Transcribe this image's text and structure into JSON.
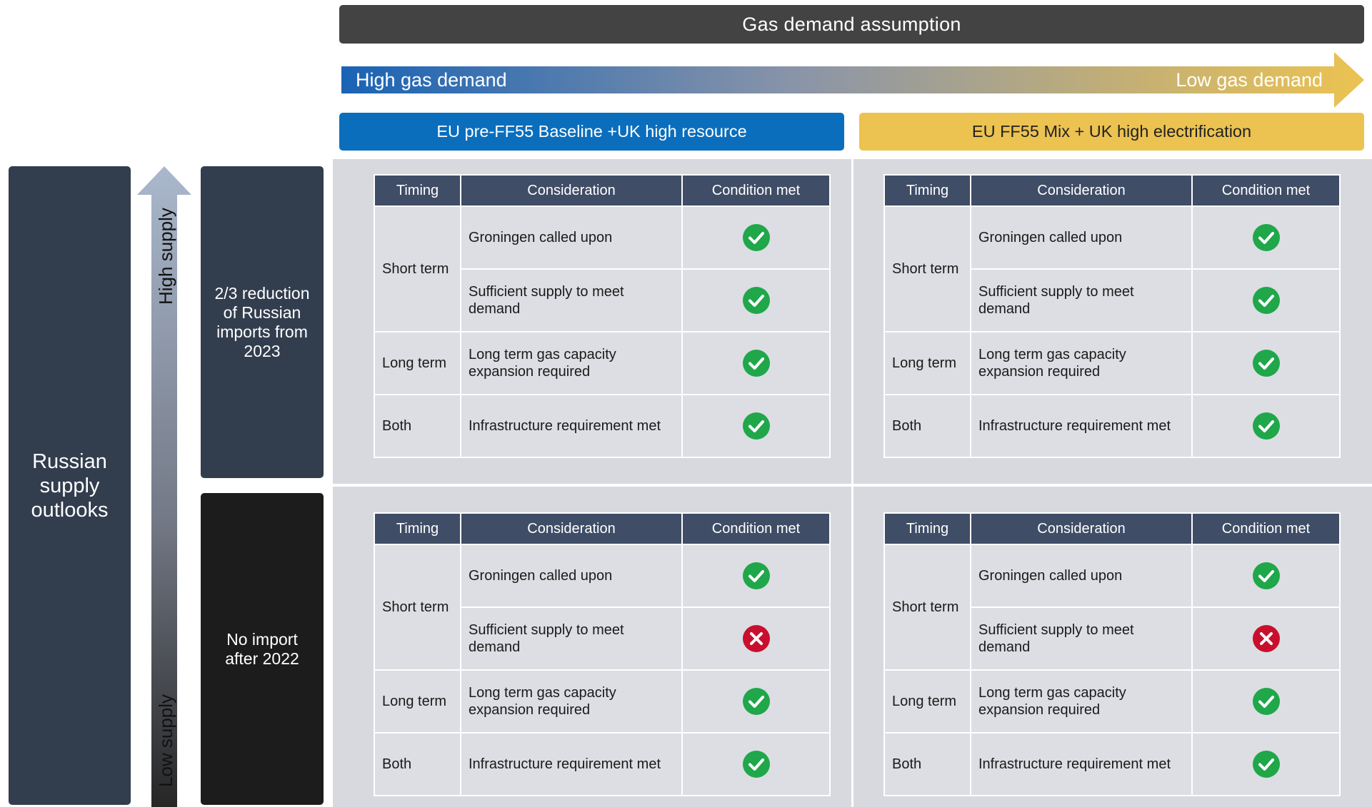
{
  "header": {
    "title": "Gas demand assumption"
  },
  "demand_arrow": {
    "left_label": "High gas demand",
    "right_label": "Low gas demand",
    "start_color": "#1a63b5",
    "end_color": "#ecc351"
  },
  "scenarios": {
    "left": {
      "label": "EU pre-FF55 Baseline +UK high resource",
      "color": "#0a6ebd"
    },
    "right": {
      "label": "EU FF55 Mix + UK high electrification",
      "color": "#ecc351"
    }
  },
  "left_panel": {
    "title": "Russian supply outlooks",
    "high_supply_label": "High supply",
    "low_supply_label": "Low supply",
    "rows": [
      {
        "label": "2/3 reduction of Russian imports from 2023"
      },
      {
        "label": "No import after 2022"
      }
    ]
  },
  "table_headers": {
    "timing": "Timing",
    "consideration": "Consideration",
    "condition": "Condition met"
  },
  "colors": {
    "check": "#1fa74a",
    "cross": "#c8102e",
    "table_header": "#3f4d66"
  },
  "quadrants": {
    "top_left": {
      "short_term": "Short term",
      "long_term": "Long term",
      "both": "Both",
      "rows": [
        {
          "consideration": "Groningen called upon",
          "status": "check"
        },
        {
          "consideration": "Sufficient supply to meet demand",
          "status": "check"
        },
        {
          "consideration": "Long term gas capacity expansion required",
          "status": "check"
        },
        {
          "consideration": "Infrastructure requirement met",
          "status": "check"
        }
      ]
    },
    "top_right": {
      "short_term": "Short term",
      "long_term": "Long term",
      "both": "Both",
      "rows": [
        {
          "consideration": "Groningen called upon",
          "status": "check"
        },
        {
          "consideration": "Sufficient supply to meet demand",
          "status": "check"
        },
        {
          "consideration": "Long term gas capacity expansion required",
          "status": "check"
        },
        {
          "consideration": "Infrastructure requirement met",
          "status": "check"
        }
      ]
    },
    "bottom_left": {
      "short_term": "Short term",
      "long_term": "Long term",
      "both": "Both",
      "rows": [
        {
          "consideration": "Groningen called upon",
          "status": "check"
        },
        {
          "consideration": "Sufficient supply to meet demand",
          "status": "cross"
        },
        {
          "consideration": "Long term gas capacity expansion required",
          "status": "check"
        },
        {
          "consideration": "Infrastructure requirement met",
          "status": "check"
        }
      ]
    },
    "bottom_right": {
      "short_term": "Short term",
      "long_term": "Long term",
      "both": "Both",
      "rows": [
        {
          "consideration": "Groningen called upon",
          "status": "check"
        },
        {
          "consideration": "Sufficient supply to meet demand",
          "status": "cross"
        },
        {
          "consideration": "Long term gas capacity expansion required",
          "status": "check"
        },
        {
          "consideration": "Infrastructure requirement met",
          "status": "check"
        }
      ]
    }
  }
}
